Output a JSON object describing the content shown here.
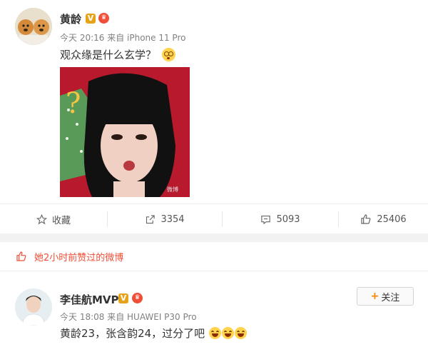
{
  "post": {
    "author": "黄龄",
    "verified_badge": "V",
    "meta": "今天 20:16 来自 iPhone 11 Pro",
    "text": "观众缘是什么玄学？",
    "question_mark": "?",
    "watermark": "微博",
    "actions": {
      "favorite_label": "收藏",
      "share_count": "3354",
      "comment_count": "5093",
      "like_count": "25406"
    }
  },
  "liked_banner": {
    "text": "她2小时前赞过的微博"
  },
  "repost": {
    "author": "李佳航MVP",
    "verified_badge": "V",
    "meta": "今天 18:08 来自 HUAWEI P30 Pro",
    "text": "黄龄23，张含韵24，过分了吧",
    "follow_label": "关注",
    "follow_plus": "+"
  },
  "colors": {
    "accent_orange": "#ff8200",
    "verified_gold": "#e8a21a",
    "like_red": "#f04e36",
    "photo_bg": "#c0182e"
  }
}
